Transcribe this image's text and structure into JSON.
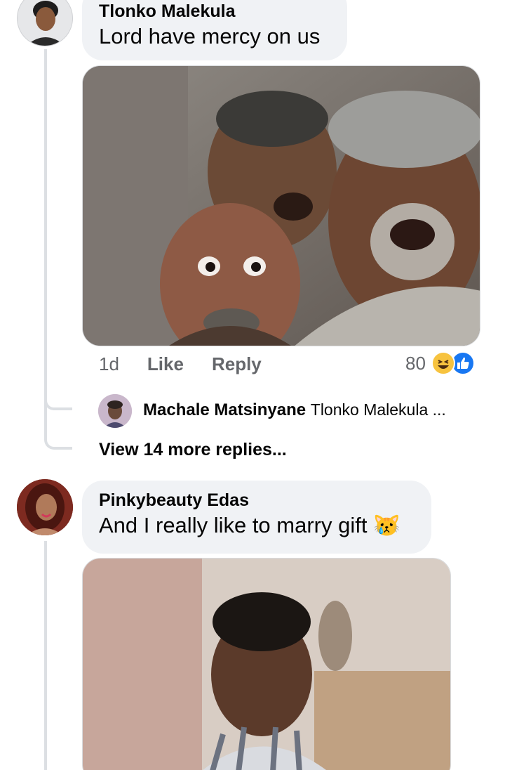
{
  "comment1": {
    "author": "Tlonko Malekula",
    "text": "Lord have mercy on us",
    "timestamp": "1d",
    "like_label": "Like",
    "reply_label": "Reply",
    "reaction_count": "80",
    "reaction_icons": [
      "haha-emoji-icon",
      "like-thumb-icon"
    ]
  },
  "reply_preview": {
    "author": "Machale Matsinyane",
    "text": "Tlonko Malekula ..."
  },
  "view_more_label": "View 14 more replies...",
  "comment2": {
    "author": "Pinkybeauty Edas",
    "text": "And I really like to marry gift",
    "emoji": "😿"
  },
  "colors": {
    "bubble_bg": "#f0f2f5",
    "thread_line": "#dcdfe3",
    "meta_text": "#65676b",
    "like_blue": "#1877f2",
    "haha_yellow": "#f7c33f"
  }
}
